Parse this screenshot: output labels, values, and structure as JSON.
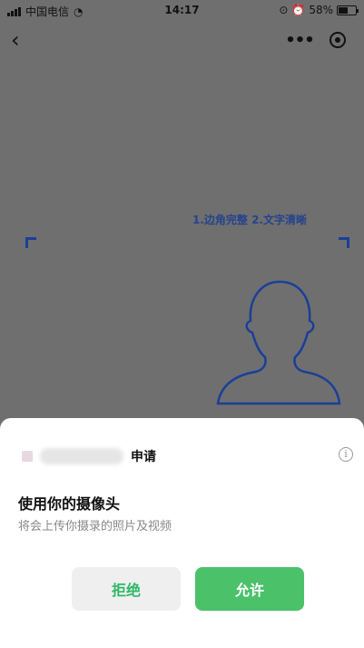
{
  "status_bar": {
    "carrier": "中国电信",
    "time": "14:17",
    "battery": "58%",
    "battery_level": 0.58
  },
  "camera": {
    "hint": "1.边角完整 2.文字清晰"
  },
  "sheet": {
    "request_label": "申请",
    "info_icon": "i",
    "permission_title": "使用你的摄像头",
    "permission_desc": "将会上传你摄录的照片及视频",
    "reject_label": "拒绝",
    "allow_label": "允许"
  },
  "colors": {
    "accent": "#4bc16a",
    "frame": "#1b3f97",
    "overlay": "#6f6f6f"
  }
}
